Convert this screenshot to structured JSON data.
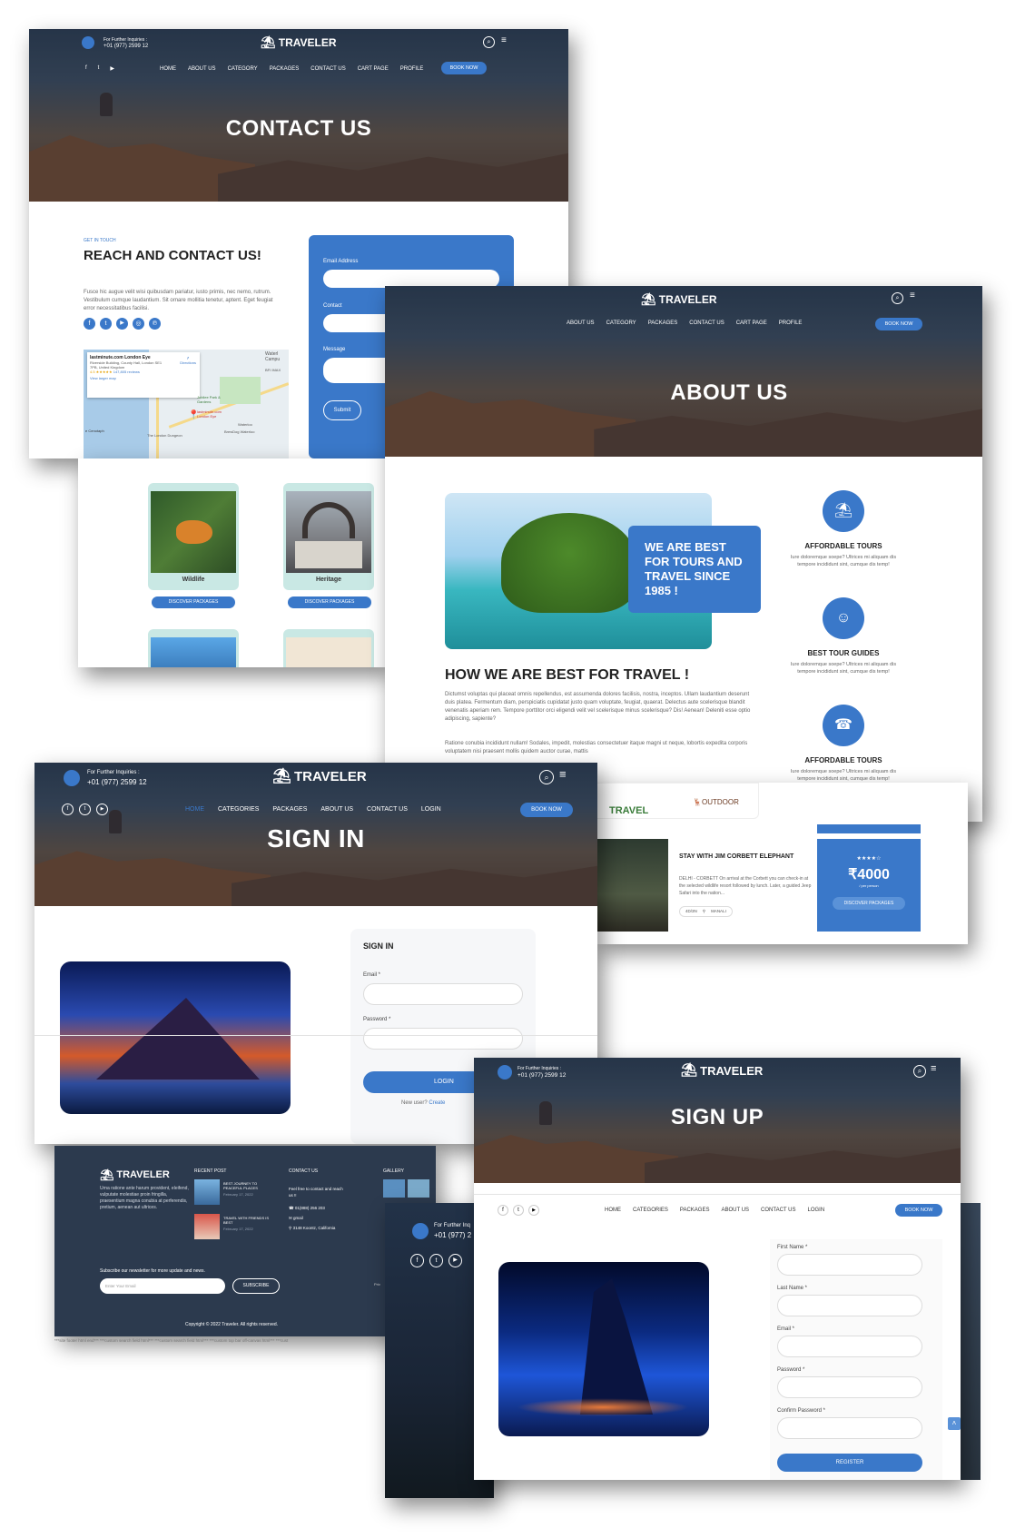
{
  "brand": "TRAVELER",
  "contact": {
    "phone_label": "For Further Inquiries :",
    "phone": "+01 (977) 2599 12",
    "nav": [
      "HOME",
      "ABOUT US",
      "CATEGORY",
      "PACKAGES",
      "CONTACT US",
      "CART PAGE",
      "PROFILE"
    ],
    "book": "BOOK NOW",
    "title": "CONTACT US",
    "kicker": "GET IN TOUCH",
    "heading": "REACH AND CONTACT US!",
    "para": "Fusce hic augue velit wisi quibusdam pariatur, iusto primis, nec nemo, rutrum. Vestibulum cumque laudantium. Sit ornare mollitia tenetur, aptent. Eget feugiat error necessitatibus facilisi.",
    "form": {
      "email": "Email Address",
      "contact": "Contact",
      "message": "Message",
      "submit": "Submit"
    },
    "map": {
      "place": "lastminute.com London Eye",
      "addr": "Riverside Building, County Hall, London SE1 7PB, United Kingdom",
      "rating": "4.5 ★★★★★",
      "reviews": "147,805 reviews",
      "link": "View larger map",
      "directions": "Directions",
      "labels": [
        "Waterl Campu",
        "BFI IMAX",
        "Jubilee Park & Gardens",
        "Waterloo",
        "BrewDog Waterloo",
        "The London Dungeon",
        "e Cenotaph",
        "lastminute.com London Eye"
      ]
    }
  },
  "categories": {
    "items": [
      {
        "name": "Wildlife",
        "btn": "DISCOVER PACKAGES"
      },
      {
        "name": "Heritage",
        "btn": "DISCOVER PACKAGES"
      }
    ]
  },
  "about": {
    "nav": [
      "ABOUT US",
      "CATEGORY",
      "PACKAGES",
      "CONTACT US",
      "CART PAGE",
      "PROFILE"
    ],
    "book": "BOOK NOW",
    "title": "ABOUT US",
    "callout": "WE ARE BEST FOR TOURS AND TRAVEL SINCE 1985 !",
    "heading": "HOW WE ARE BEST FOR TRAVEL !",
    "para1": "Dictumst voluptas qui placeat omnis repellendus, est assumenda dolores facilisis, nostra, inceptos. Ullam laudantium deserunt duis platea. Fermentum diam, perspiciatis cupidatat justo quam voluptate, feugiat, quaerat. Delectus aute scelerisque blandit venenatis aperiam rem. Tempore porttitor orci eligendi velit vel scelerisque minus scelerisque? Dis! Aenean! Deleniti esse optio adipiscing, sapiente?",
    "para2": "Ratione conubia incididunt nullam! Sodales, impedit, molestias consectetuer itaque magni ut neque, lobortis expedita corporis voluptatem nisi praesent mollis quidem auctor curae, mattis",
    "features": [
      {
        "title": "AFFORDABLE TOURS",
        "text": "Iure doloremque soepe? Ultrices mi aliquam dis tempore incididunt sint, cumque dis temp!"
      },
      {
        "title": "BEST TOUR GUIDES",
        "text": "Iure doloremque soepe? Ultrices mi aliquam dis tempore incididunt sint, cumque dis temp!"
      },
      {
        "title": "AFFORDABLE TOURS",
        "text": "Iure doloremque soepe? Ultrices mi aliquam dis tempore incididunt sint, cumque dis temp!"
      }
    ]
  },
  "package": {
    "logos": [
      "TRAVEL",
      "OUTDOOR"
    ],
    "title": "STAY WITH JIM CORBETT ELEPHANT",
    "desc": "DELHI - CORBETT On arrival at the Corbett you can check-in at the selected wildlife resort followed by lunch. Later, a guided Jeep Safari into the nation...",
    "meta1": "4D/3N",
    "meta2": "MANALI",
    "stars": "★★★★☆",
    "price": "₹4000",
    "per": "/ per person",
    "btn": "DISCOVER PACKAGES"
  },
  "signin": {
    "phone_label": "For Further Inquiries :",
    "phone": "+01 (977) 2599 12",
    "nav": [
      "HOME",
      "CATEGORIES",
      "PACKAGES",
      "ABOUT US",
      "CONTACT US",
      "LOGIN"
    ],
    "book": "BOOK NOW",
    "title": "SIGN IN",
    "form_title": "SIGN IN",
    "email": "Email *",
    "password": "Password *",
    "login": "LOGIN",
    "newuser": "New user?",
    "create": "Create"
  },
  "footer": {
    "about": "Urna ratione ante harum provident, eleifend, vulputate molestiae proin fringilla, praesentium magna conubia at perferendis, pretium, aenean aut ultrices.",
    "recent_title": "RECENT POST",
    "posts": [
      {
        "t": "BEST JOURNEY TO PEACEFUL PLACES",
        "d": "February 17, 2022"
      },
      {
        "t": "TRAVEL WITH FRIENDS IS BEST",
        "d": "February 17, 2022"
      }
    ],
    "contact_title": "CONTACT US",
    "contact_text": "Feel free to contact and reach us !!",
    "phone": "01(888) 256 203",
    "mail": "gmail",
    "address": "3148 Koontz, California",
    "gallery_title": "GALLERY",
    "newsletter": "Subscribe our newsletter for more update and news.",
    "email_ph": "Enter Your Email",
    "subscribe": "SUBSCRIBE",
    "copyright": "Copyright © 2022 Traveler. All rights reserved.",
    "code": "***site footer html end*** ***custom search field html*** ***custom search field html*** ***custom top bar off-canvas html*** ***cust",
    "partial_label": "For Further Inq",
    "partial_phone": "+01 (977) 2",
    "priv": "Priv"
  },
  "signup": {
    "phone_label": "For Further Inquiries :",
    "phone": "+01 (977) 2599 12",
    "title": "SIGN UP",
    "nav": [
      "HOME",
      "CATEGORIES",
      "PACKAGES",
      "ABOUT US",
      "CONTACT US",
      "LOGIN"
    ],
    "book": "BOOK NOW",
    "fields": [
      "First Name *",
      "Last Name *",
      "Email *",
      "Password *",
      "Confirm Password *"
    ],
    "register": "REGISTER"
  },
  "colors": {
    "accent": "#3a78c9",
    "footer": "#2c3a4e"
  }
}
